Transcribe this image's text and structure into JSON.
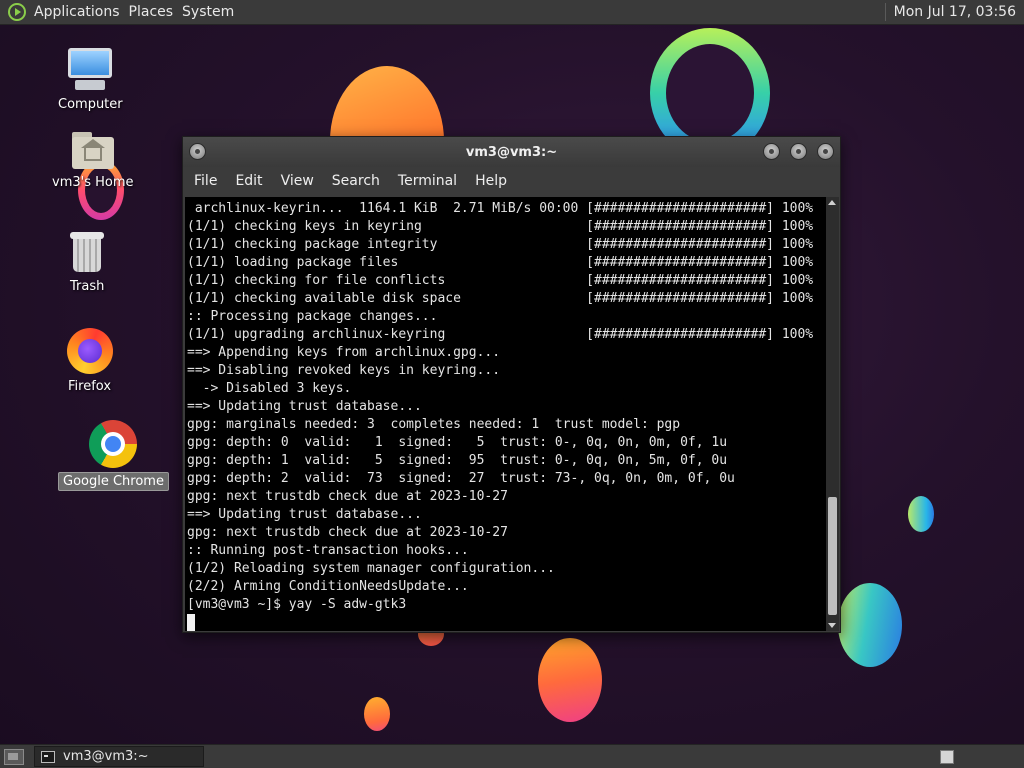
{
  "top_panel": {
    "menus": [
      "Applications",
      "Places",
      "System"
    ],
    "clock": "Mon Jul 17, 03:56"
  },
  "desktop_icons": [
    {
      "label": "Computer",
      "icon": "computer-icon"
    },
    {
      "label": "vm3's Home",
      "icon": "home-folder-icon"
    },
    {
      "label": "Trash",
      "icon": "trash-icon"
    },
    {
      "label": "Firefox",
      "icon": "firefox-icon"
    },
    {
      "label": "Google Chrome",
      "icon": "chrome-icon",
      "selected": true
    }
  ],
  "terminal": {
    "title": "vm3@vm3:~",
    "menu": [
      "File",
      "Edit",
      "View",
      "Search",
      "Terminal",
      "Help"
    ],
    "lines": [
      " archlinux-keyrin...  1164.1 KiB  2.71 MiB/s 00:00 [######################] 100%",
      "(1/1) checking keys in keyring                     [######################] 100%",
      "(1/1) checking package integrity                   [######################] 100%",
      "(1/1) loading package files                        [######################] 100%",
      "(1/1) checking for file conflicts                  [######################] 100%",
      "(1/1) checking available disk space                [######################] 100%",
      ":: Processing package changes...",
      "(1/1) upgrading archlinux-keyring                  [######################] 100%",
      "==> Appending keys from archlinux.gpg...",
      "==> Disabling revoked keys in keyring...",
      "  -> Disabled 3 keys.",
      "==> Updating trust database...",
      "gpg: marginals needed: 3  completes needed: 1  trust model: pgp",
      "gpg: depth: 0  valid:   1  signed:   5  trust: 0-, 0q, 0n, 0m, 0f, 1u",
      "gpg: depth: 1  valid:   5  signed:  95  trust: 0-, 0q, 0n, 5m, 0f, 0u",
      "gpg: depth: 2  valid:  73  signed:  27  trust: 73-, 0q, 0n, 0m, 0f, 0u",
      "gpg: next trustdb check due at 2023-10-27",
      "==> Updating trust database...",
      "gpg: next trustdb check due at 2023-10-27",
      ":: Running post-transaction hooks...",
      "(1/2) Reloading system manager configuration...",
      "(2/2) Arming ConditionNeedsUpdate...",
      "[vm3@vm3 ~]$ yay -S adw-gtk3"
    ]
  },
  "taskbar": {
    "task_label": "vm3@vm3:~"
  }
}
